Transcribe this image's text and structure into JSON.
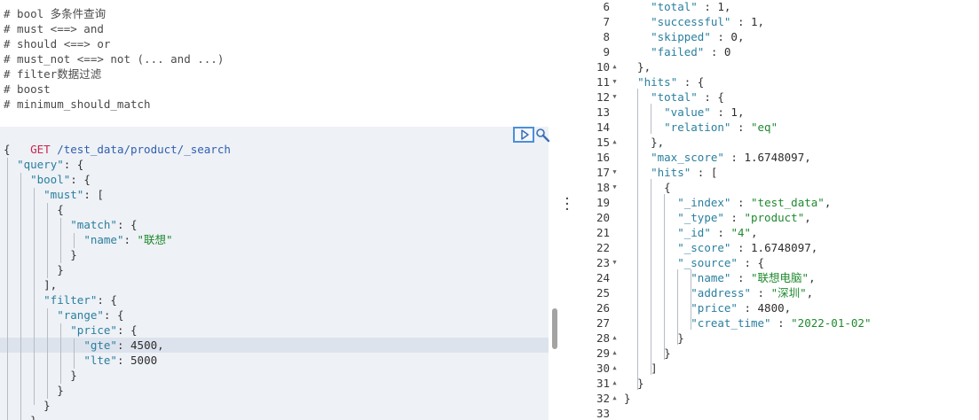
{
  "request_editor": {
    "comments": [
      "# bool 多条件查询",
      "# must <==> and",
      "# should <==> or",
      "# must_not <==> not (... and ...)",
      "# filter数据过滤",
      "# boost",
      "# minimum_should_match"
    ],
    "request_line": {
      "method": "GET",
      "path": "/test_data/product/_search"
    },
    "body_lines": [
      [
        {
          "t": "{",
          "c": "punc"
        }
      ],
      [
        {
          "t": "  ",
          "c": "punc"
        },
        {
          "t": "\"query\"",
          "c": "key"
        },
        {
          "t": ": {",
          "c": "punc"
        }
      ],
      [
        {
          "t": "    ",
          "c": "punc"
        },
        {
          "t": "\"bool\"",
          "c": "key"
        },
        {
          "t": ": {",
          "c": "punc"
        }
      ],
      [
        {
          "t": "      ",
          "c": "punc"
        },
        {
          "t": "\"must\"",
          "c": "key"
        },
        {
          "t": ": [",
          "c": "punc"
        }
      ],
      [
        {
          "t": "        {",
          "c": "punc"
        }
      ],
      [
        {
          "t": "          ",
          "c": "punc"
        },
        {
          "t": "\"match\"",
          "c": "key"
        },
        {
          "t": ": {",
          "c": "punc"
        }
      ],
      [
        {
          "t": "            ",
          "c": "punc"
        },
        {
          "t": "\"name\"",
          "c": "key"
        },
        {
          "t": ": ",
          "c": "punc"
        },
        {
          "t": "\"联想\"",
          "c": "str"
        }
      ],
      [
        {
          "t": "          }",
          "c": "punc"
        }
      ],
      [
        {
          "t": "        }",
          "c": "punc"
        }
      ],
      [
        {
          "t": "      ],",
          "c": "punc"
        }
      ],
      [
        {
          "t": "      ",
          "c": "punc"
        },
        {
          "t": "\"filter\"",
          "c": "key"
        },
        {
          "t": ": {",
          "c": "punc"
        }
      ],
      [
        {
          "t": "        ",
          "c": "punc"
        },
        {
          "t": "\"range\"",
          "c": "key"
        },
        {
          "t": ": {",
          "c": "punc"
        }
      ],
      [
        {
          "t": "          ",
          "c": "punc"
        },
        {
          "t": "\"price\"",
          "c": "key"
        },
        {
          "t": ": {",
          "c": "punc"
        }
      ],
      [
        {
          "t": "            ",
          "c": "punc"
        },
        {
          "t": "\"gte\"",
          "c": "key"
        },
        {
          "t": ": ",
          "c": "punc"
        },
        {
          "t": "4500",
          "c": "num"
        },
        {
          "t": ",",
          "c": "punc"
        }
      ],
      [
        {
          "t": "            ",
          "c": "punc"
        },
        {
          "t": "\"lte\"",
          "c": "key"
        },
        {
          "t": ": ",
          "c": "punc"
        },
        {
          "t": "5000",
          "c": "num"
        }
      ],
      [
        {
          "t": "          }",
          "c": "punc"
        }
      ],
      [
        {
          "t": "        }",
          "c": "punc"
        }
      ],
      [
        {
          "t": "      }",
          "c": "punc"
        }
      ],
      [
        {
          "t": "    }",
          "c": "punc"
        }
      ]
    ],
    "run_icon": "play-icon",
    "settings_icon": "wrench-icon"
  },
  "response_viewer": {
    "lines": [
      {
        "n": "6",
        "fold": "",
        "s": [
          {
            "t": "    ",
            "c": "punc"
          },
          {
            "t": "\"total\"",
            "c": "key"
          },
          {
            "t": " : ",
            "c": "punc"
          },
          {
            "t": "1",
            "c": "num"
          },
          {
            "t": ",",
            "c": "punc"
          }
        ]
      },
      {
        "n": "7",
        "fold": "",
        "s": [
          {
            "t": "    ",
            "c": "punc"
          },
          {
            "t": "\"successful\"",
            "c": "key"
          },
          {
            "t": " : ",
            "c": "punc"
          },
          {
            "t": "1",
            "c": "num"
          },
          {
            "t": ",",
            "c": "punc"
          }
        ]
      },
      {
        "n": "8",
        "fold": "",
        "s": [
          {
            "t": "    ",
            "c": "punc"
          },
          {
            "t": "\"skipped\"",
            "c": "key"
          },
          {
            "t": " : ",
            "c": "punc"
          },
          {
            "t": "0",
            "c": "num"
          },
          {
            "t": ",",
            "c": "punc"
          }
        ]
      },
      {
        "n": "9",
        "fold": "",
        "s": [
          {
            "t": "    ",
            "c": "punc"
          },
          {
            "t": "\"failed\"",
            "c": "key"
          },
          {
            "t": " : ",
            "c": "punc"
          },
          {
            "t": "0",
            "c": "num"
          }
        ]
      },
      {
        "n": "10",
        "fold": "▲",
        "s": [
          {
            "t": "  },",
            "c": "punc"
          }
        ]
      },
      {
        "n": "11",
        "fold": "▼",
        "s": [
          {
            "t": "  ",
            "c": "punc"
          },
          {
            "t": "\"hits\"",
            "c": "key"
          },
          {
            "t": " : {",
            "c": "punc"
          }
        ]
      },
      {
        "n": "12",
        "fold": "▼",
        "s": [
          {
            "t": "    ",
            "c": "punc"
          },
          {
            "t": "\"total\"",
            "c": "key"
          },
          {
            "t": " : {",
            "c": "punc"
          }
        ]
      },
      {
        "n": "13",
        "fold": "",
        "s": [
          {
            "t": "      ",
            "c": "punc"
          },
          {
            "t": "\"value\"",
            "c": "key"
          },
          {
            "t": " : ",
            "c": "punc"
          },
          {
            "t": "1",
            "c": "num"
          },
          {
            "t": ",",
            "c": "punc"
          }
        ]
      },
      {
        "n": "14",
        "fold": "",
        "s": [
          {
            "t": "      ",
            "c": "punc"
          },
          {
            "t": "\"relation\"",
            "c": "key"
          },
          {
            "t": " : ",
            "c": "punc"
          },
          {
            "t": "\"eq\"",
            "c": "str"
          }
        ]
      },
      {
        "n": "15",
        "fold": "▲",
        "s": [
          {
            "t": "    },",
            "c": "punc"
          }
        ]
      },
      {
        "n": "16",
        "fold": "",
        "s": [
          {
            "t": "    ",
            "c": "punc"
          },
          {
            "t": "\"max_score\"",
            "c": "key"
          },
          {
            "t": " : ",
            "c": "punc"
          },
          {
            "t": "1.6748097",
            "c": "num"
          },
          {
            "t": ",",
            "c": "punc"
          }
        ]
      },
      {
        "n": "17",
        "fold": "▼",
        "s": [
          {
            "t": "    ",
            "c": "punc"
          },
          {
            "t": "\"hits\"",
            "c": "key"
          },
          {
            "t": " : [",
            "c": "punc"
          }
        ]
      },
      {
        "n": "18",
        "fold": "▼",
        "s": [
          {
            "t": "      {",
            "c": "punc"
          }
        ]
      },
      {
        "n": "19",
        "fold": "",
        "s": [
          {
            "t": "        ",
            "c": "punc"
          },
          {
            "t": "\"_index\"",
            "c": "key"
          },
          {
            "t": " : ",
            "c": "punc"
          },
          {
            "t": "\"test_data\"",
            "c": "str"
          },
          {
            "t": ",",
            "c": "punc"
          }
        ]
      },
      {
        "n": "20",
        "fold": "",
        "s": [
          {
            "t": "        ",
            "c": "punc"
          },
          {
            "t": "\"_type\"",
            "c": "key"
          },
          {
            "t": " : ",
            "c": "punc"
          },
          {
            "t": "\"product\"",
            "c": "str"
          },
          {
            "t": ",",
            "c": "punc"
          }
        ]
      },
      {
        "n": "21",
        "fold": "",
        "s": [
          {
            "t": "        ",
            "c": "punc"
          },
          {
            "t": "\"_id\"",
            "c": "key"
          },
          {
            "t": " : ",
            "c": "punc"
          },
          {
            "t": "\"4\"",
            "c": "str"
          },
          {
            "t": ",",
            "c": "punc"
          }
        ]
      },
      {
        "n": "22",
        "fold": "",
        "s": [
          {
            "t": "        ",
            "c": "punc"
          },
          {
            "t": "\"_score\"",
            "c": "key"
          },
          {
            "t": " : ",
            "c": "punc"
          },
          {
            "t": "1.6748097",
            "c": "num"
          },
          {
            "t": ",",
            "c": "punc"
          }
        ]
      },
      {
        "n": "23",
        "fold": "▼",
        "s": [
          {
            "t": "        ",
            "c": "punc"
          },
          {
            "t": "\"_source\"",
            "c": "key"
          },
          {
            "t": " : {",
            "c": "punc"
          }
        ]
      },
      {
        "n": "24",
        "fold": "",
        "s": [
          {
            "t": "          ",
            "c": "punc"
          },
          {
            "t": "\"name\"",
            "c": "key"
          },
          {
            "t": " : ",
            "c": "punc"
          },
          {
            "t": "\"联想电脑\"",
            "c": "str"
          },
          {
            "t": ",",
            "c": "punc"
          }
        ]
      },
      {
        "n": "25",
        "fold": "",
        "s": [
          {
            "t": "          ",
            "c": "punc"
          },
          {
            "t": "\"address\"",
            "c": "key"
          },
          {
            "t": " : ",
            "c": "punc"
          },
          {
            "t": "\"深圳\"",
            "c": "str"
          },
          {
            "t": ",",
            "c": "punc"
          }
        ]
      },
      {
        "n": "26",
        "fold": "",
        "s": [
          {
            "t": "          ",
            "c": "punc"
          },
          {
            "t": "\"price\"",
            "c": "key"
          },
          {
            "t": " : ",
            "c": "punc"
          },
          {
            "t": "4800",
            "c": "num"
          },
          {
            "t": ",",
            "c": "punc"
          }
        ]
      },
      {
        "n": "27",
        "fold": "",
        "s": [
          {
            "t": "          ",
            "c": "punc"
          },
          {
            "t": "\"creat_time\"",
            "c": "key"
          },
          {
            "t": " : ",
            "c": "punc"
          },
          {
            "t": "\"2022-01-02\"",
            "c": "str"
          }
        ]
      },
      {
        "n": "28",
        "fold": "▲",
        "s": [
          {
            "t": "        }",
            "c": "punc"
          }
        ]
      },
      {
        "n": "29",
        "fold": "▲",
        "s": [
          {
            "t": "      }",
            "c": "punc"
          }
        ]
      },
      {
        "n": "30",
        "fold": "▲",
        "s": [
          {
            "t": "    ]",
            "c": "punc"
          }
        ]
      },
      {
        "n": "31",
        "fold": "▲",
        "s": [
          {
            "t": "  }",
            "c": "punc"
          }
        ]
      },
      {
        "n": "32",
        "fold": "▲",
        "s": [
          {
            "t": "}",
            "c": "punc"
          }
        ]
      },
      {
        "n": "33",
        "fold": "",
        "s": []
      }
    ]
  },
  "splitter": {
    "icon": "drag-handle-icon"
  },
  "colors": {
    "comment": "#4a4a4a",
    "method": "#c7254e",
    "path": "#2f5fae",
    "key": "#2a7f9e",
    "string": "#1f8a2e",
    "number": "#2d2d2d",
    "request_highlight": "#eef1f6",
    "run_button_border": "#4d8fd8"
  }
}
